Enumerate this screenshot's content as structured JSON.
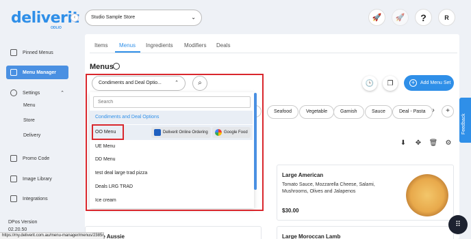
{
  "brand": {
    "name": "deliverit",
    "sub": "ODLIO",
    "color": "#2f8fe8"
  },
  "sidebar": {
    "items": [
      {
        "label": "Pinned Menus",
        "icon": "pin-icon"
      },
      {
        "label": "Menu Manager",
        "icon": "book-icon",
        "active": true
      },
      {
        "label": "Settings",
        "icon": "gear-icon"
      },
      {
        "label": "Promo Code",
        "icon": "ticket-icon"
      },
      {
        "label": "Image Library",
        "icon": "image-icon"
      },
      {
        "label": "Integrations",
        "icon": "plug-icon"
      }
    ],
    "settings_sub": [
      "Menu",
      "Store",
      "Delivery"
    ],
    "version_label": "DPos Version",
    "version_number": "02.20.50"
  },
  "header": {
    "store_select": "Studio Sample Store",
    "avatar_initial": "R"
  },
  "tabs": [
    "Items",
    "Menus",
    "Ingredients",
    "Modifiers",
    "Deals"
  ],
  "active_tab": "Menus",
  "menus_title": "Menus",
  "add_menu_label": "Add Menu Set",
  "category_chips": [
    "Seafood",
    "Vegetable",
    "Garnish",
    "Sauce",
    "Deal - Pasta"
  ],
  "dropdown": {
    "selected": "Condiments and Deal Optio...",
    "search_placeholder": "Search",
    "options": [
      "Condiments and Deal Options",
      "OO Menu",
      "UE Menu",
      "DD Menu",
      "test deal large trad pizza",
      "Deals LRG TRAD",
      "Ice cream"
    ],
    "oo_badges": [
      "Deliverit Online Ordering",
      "Google Food"
    ]
  },
  "cards": [
    {
      "title": "Large American",
      "desc": "Tomato Sauce, Mozzarella Cheese, Salami, Mushrooms, Olives and Jalapenos",
      "price": "$30.00"
    },
    {
      "title": "Large Aussie"
    },
    {
      "title": "Large Moroccan Lamb"
    }
  ],
  "feedback_label": "Feedback",
  "status_url": "https://my.deliverit.com.au/menu-manager/menus/2385#"
}
